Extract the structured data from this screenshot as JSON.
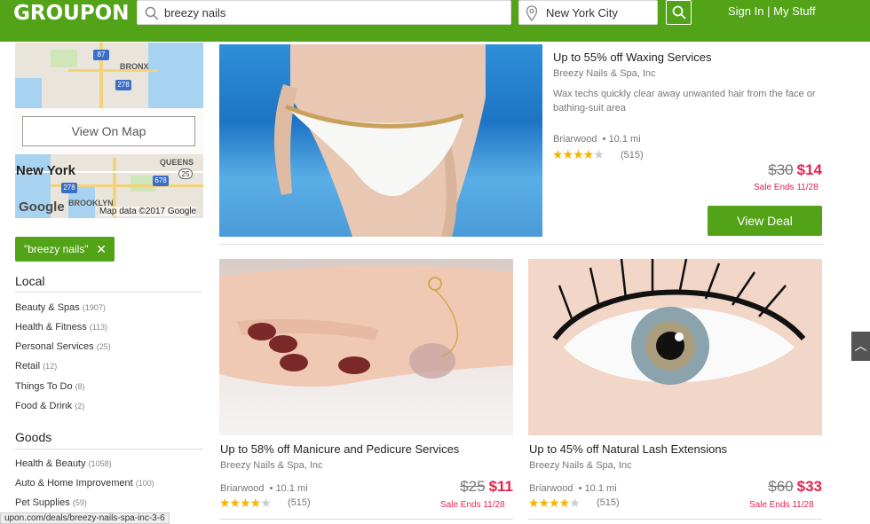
{
  "header": {
    "logo": "GROUPON",
    "search_value": "breezy nails",
    "location_value": "New York City",
    "signin": "Sign In",
    "separator": "|",
    "mystuff": "My Stuff"
  },
  "map": {
    "button": "View On Map",
    "labels": {
      "bronx": "BRONX",
      "queens": "QUEENS",
      "brooklyn": "BROOKLYN",
      "city": "New York"
    },
    "shields": [
      "87",
      "278",
      "278",
      "678",
      "25"
    ],
    "credit": "Map data ©2017 Google",
    "google": "Google"
  },
  "filter_chip": {
    "label": "\"breezy nails\"",
    "remove": "✕"
  },
  "local": {
    "title": "Local",
    "items": [
      {
        "label": "Beauty & Spas",
        "count": "(1907)"
      },
      {
        "label": "Health & Fitness",
        "count": "(113)"
      },
      {
        "label": "Personal Services",
        "count": "(25)"
      },
      {
        "label": "Retail",
        "count": "(12)"
      },
      {
        "label": "Things To Do",
        "count": "(8)"
      },
      {
        "label": "Food & Drink",
        "count": "(2)"
      }
    ]
  },
  "goods": {
    "title": "Goods",
    "items": [
      {
        "label": "Health & Beauty",
        "count": "(1058)"
      },
      {
        "label": "Auto & Home Improvement",
        "count": "(100)"
      },
      {
        "label": "Pet Supplies",
        "count": "(59)"
      }
    ]
  },
  "deals": [
    {
      "title": "Up to 55% off Waxing Services",
      "merchant": "Breezy Nails & Spa, Inc",
      "description": "Wax techs quickly clear away unwanted hair from the face or bathing-suit area",
      "location": "Briarwood",
      "distance": "• 10.1 mi",
      "rating": 4,
      "reviews": "(515)",
      "old_price": "$30",
      "new_price": "$14",
      "ends": "Sale Ends 11/28",
      "cta": "View Deal"
    },
    {
      "title": "Up to 58% off Manicure and Pedicure Services",
      "merchant": "Breezy Nails & Spa, Inc",
      "location": "Briarwood",
      "distance": "• 10.1 mi",
      "rating": 4,
      "reviews": "(515)",
      "old_price": "$25",
      "new_price": "$11",
      "ends": "Sale Ends 11/28"
    },
    {
      "title": "Up to 45% off Natural Lash Extensions",
      "merchant": "Breezy Nails & Spa, Inc",
      "location": "Briarwood",
      "distance": "• 10.1 mi",
      "rating": 4,
      "reviews": "(515)",
      "old_price": "$60",
      "new_price": "$33",
      "ends": "Sale Ends 11/28"
    }
  ],
  "status_url": "upon.com/deals/breezy-nails-spa-inc-3-6",
  "colors": {
    "brand": "#53a318",
    "sale": "#e9214e",
    "star": "#f3b300"
  }
}
